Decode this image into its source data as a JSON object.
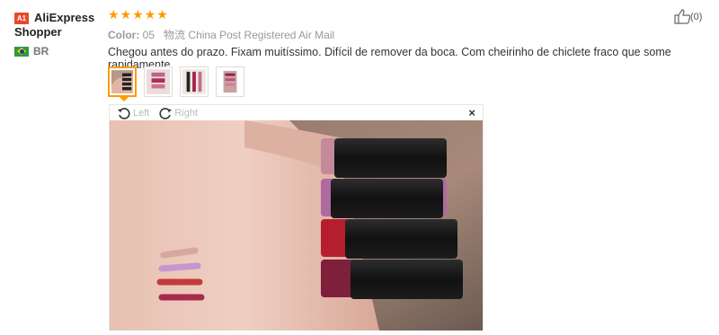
{
  "user": {
    "badge": "A1",
    "name_line1": "AliExpress",
    "name_line2": "Shopper",
    "country": "BR"
  },
  "review": {
    "rating": 5,
    "color_label": "Color:",
    "color_value": "05",
    "shipping_cn": "物流",
    "shipping_method": "China Post Registered Air Mail",
    "text": "Chegou antes do prazo. Fixam muitíssimo. Difícil de remover da boca. Com cheirinho de chiclete fraco que some rapidamente.",
    "helpful_count": "(0)"
  },
  "viewer": {
    "left_label": "Left",
    "right_label": "Right",
    "close_label": "×"
  },
  "colors": {
    "star": "#ff9a00",
    "active_thumb": "#ff9a00"
  }
}
